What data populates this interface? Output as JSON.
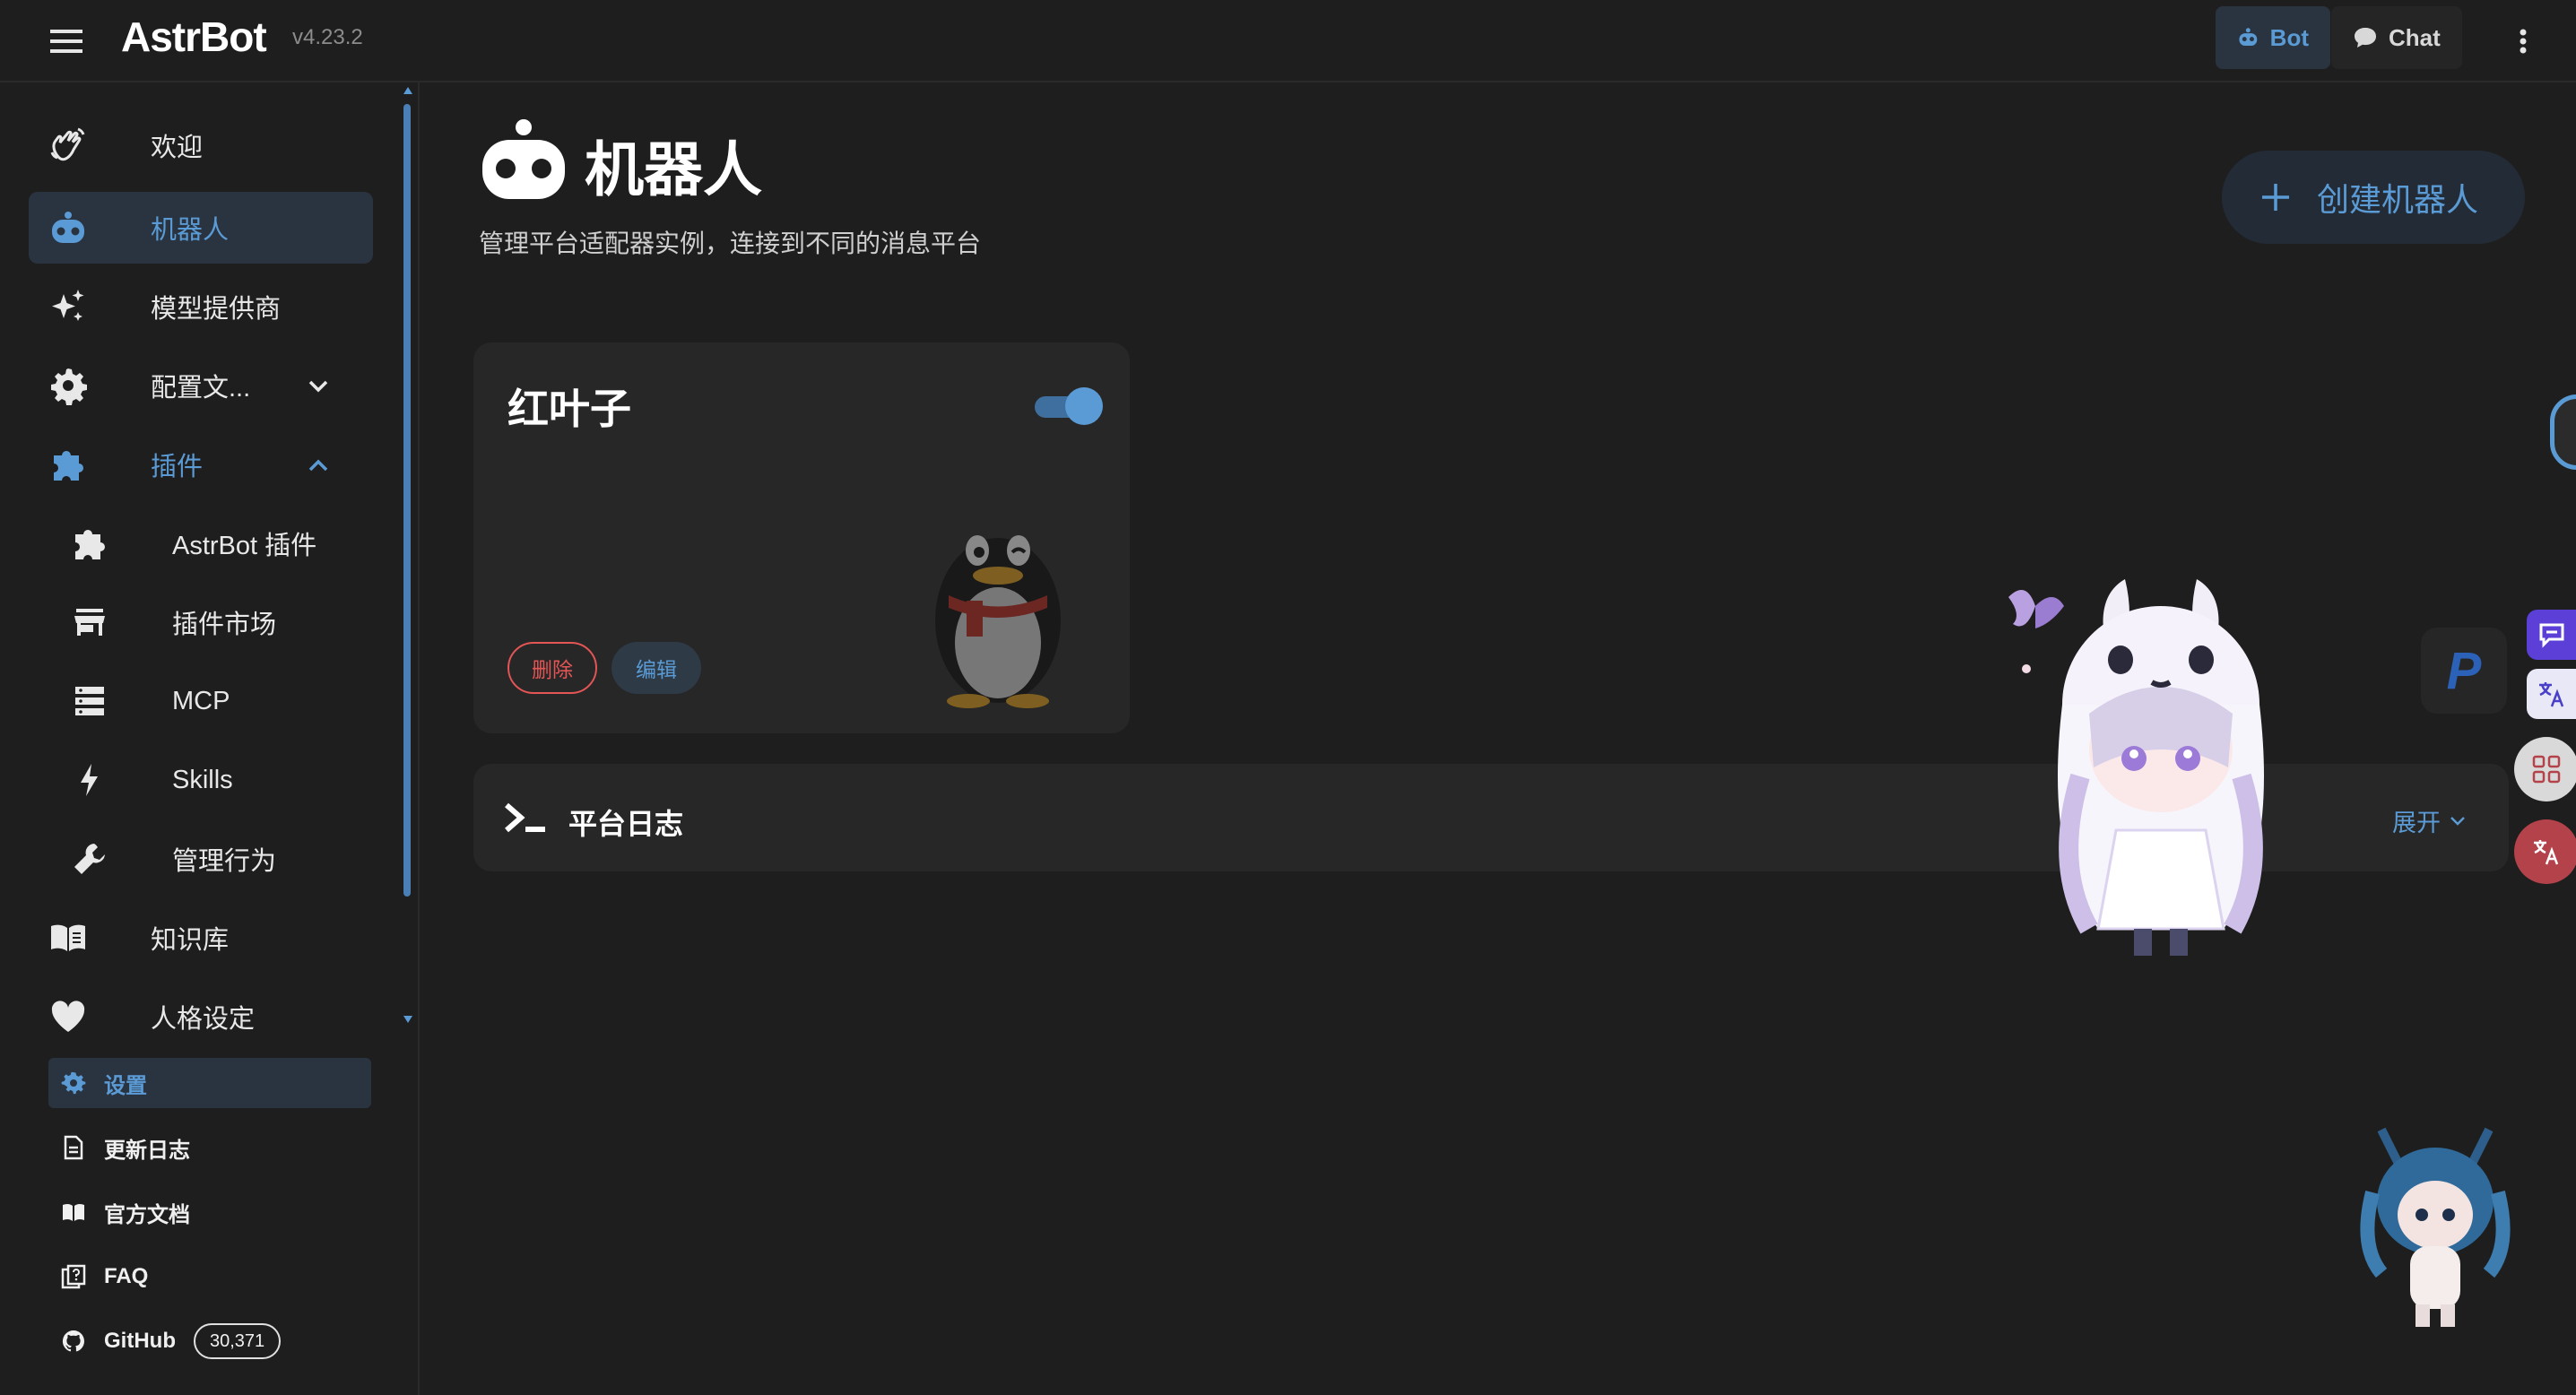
{
  "app": {
    "name": "AstrBot",
    "version": "v4.23.2"
  },
  "topbar": {
    "bot_label": "Bot",
    "chat_label": "Chat"
  },
  "sidebar": {
    "items": [
      {
        "label": "欢迎"
      },
      {
        "label": "机器人"
      },
      {
        "label": "模型提供商"
      },
      {
        "label": "配置文..."
      },
      {
        "label": "插件"
      },
      {
        "label": "AstrBot 插件"
      },
      {
        "label": "插件市场"
      },
      {
        "label": "MCP"
      },
      {
        "label": "Skills"
      },
      {
        "label": "管理行为"
      },
      {
        "label": "知识库"
      },
      {
        "label": "人格设定"
      }
    ],
    "footer": [
      {
        "label": "设置"
      },
      {
        "label": "更新日志"
      },
      {
        "label": "官方文档"
      },
      {
        "label": "FAQ"
      },
      {
        "label": "GitHub",
        "count": "30,371"
      }
    ]
  },
  "main": {
    "title": "机器人",
    "subtitle": "管理平台适配器实例，连接到不同的消息平台",
    "create_label": "创建机器人",
    "bots": [
      {
        "name": "红叶子",
        "enabled": true,
        "delete_label": "删除",
        "edit_label": "编辑",
        "platform_icon": "qq-penguin-icon"
      }
    ],
    "log_panel": {
      "title": "平台日志",
      "expand_label": "展开"
    }
  },
  "floating": {
    "paypal_label": "P"
  },
  "colors": {
    "accent": "#5b9bd5",
    "danger": "#e45555",
    "background": "#1e1e1e",
    "card": "#272727"
  }
}
